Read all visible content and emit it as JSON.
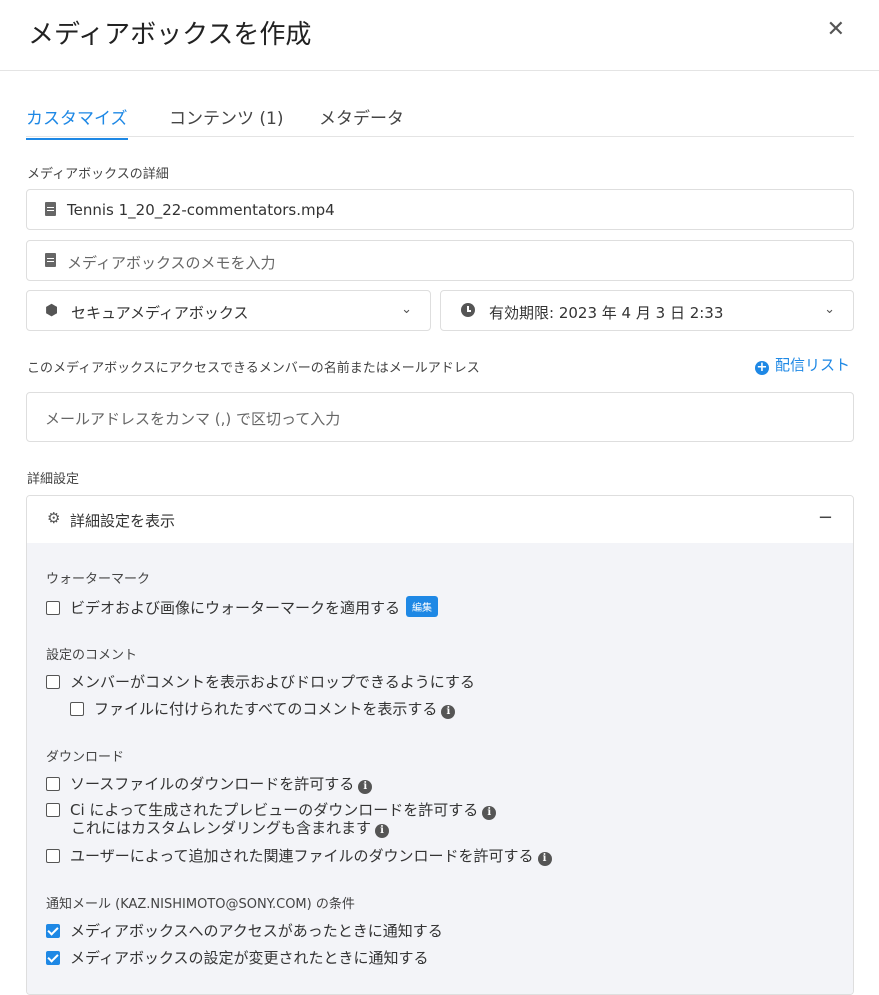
{
  "dialog": {
    "title": "メディアボックスを作成",
    "close_glyph": "✕"
  },
  "tabs": [
    {
      "label": "カスタマイズ",
      "active": true
    },
    {
      "label": "コンテンツ (1)",
      "active": false
    },
    {
      "label": "メタデータ",
      "active": false
    }
  ],
  "details": {
    "section_label": "メディアボックスの詳細",
    "name_value": "Tennis 1_20_22-commentators.mp4",
    "note_placeholder": "メディアボックスのメモを入力",
    "type_value": "セキュアメディアボックス",
    "expiry_label": "有効期限:",
    "expiry_value": "2023 年 4 月 3 日 2:33"
  },
  "access": {
    "label": "このメディアボックスにアクセスできるメンバーの名前またはメールアドレス",
    "distribution_list": "配信リスト",
    "email_placeholder": "メールアドレスをカンマ (,) で区切って入力"
  },
  "advanced": {
    "section_label": "詳細設定",
    "toggle_label": "詳細設定を表示",
    "collapse_glyph": "−",
    "watermark": {
      "heading": "ウォーターマーク",
      "apply_label": "ビデオおよび画像にウォーターマークを適用する",
      "apply_checked": false,
      "edit_badge": "編集"
    },
    "comments": {
      "heading": "設定のコメント",
      "allow_label": "メンバーがコメントを表示およびドロップできるようにする",
      "allow_checked": false,
      "show_all_label": "ファイルに付けられたすべてのコメントを表示する",
      "show_all_checked": false
    },
    "download": {
      "heading": "ダウンロード",
      "source_label": "ソースファイルのダウンロードを許可する",
      "source_checked": false,
      "preview_label": "Ci によって生成されたプレビューのダウンロードを許可する",
      "preview_sublabel": "これにはカスタムレンダリングも含まれます",
      "preview_checked": false,
      "related_label": "ユーザーによって追加された関連ファイルのダウンロードを許可する",
      "related_checked": false
    },
    "notify": {
      "heading": "通知メール (KAZ.NISHIMOTO@SONY.COM) の条件",
      "access_label": "メディアボックスへのアクセスがあったときに通知する",
      "access_checked": true,
      "changed_label": "メディアボックスの設定が変更されたときに通知する",
      "changed_checked": true
    }
  },
  "icons": {
    "info": "i",
    "chevron": "⌄",
    "plus": "+"
  },
  "colors": {
    "accent": "#1e88e5",
    "panel_bg": "#f3f4f8"
  }
}
